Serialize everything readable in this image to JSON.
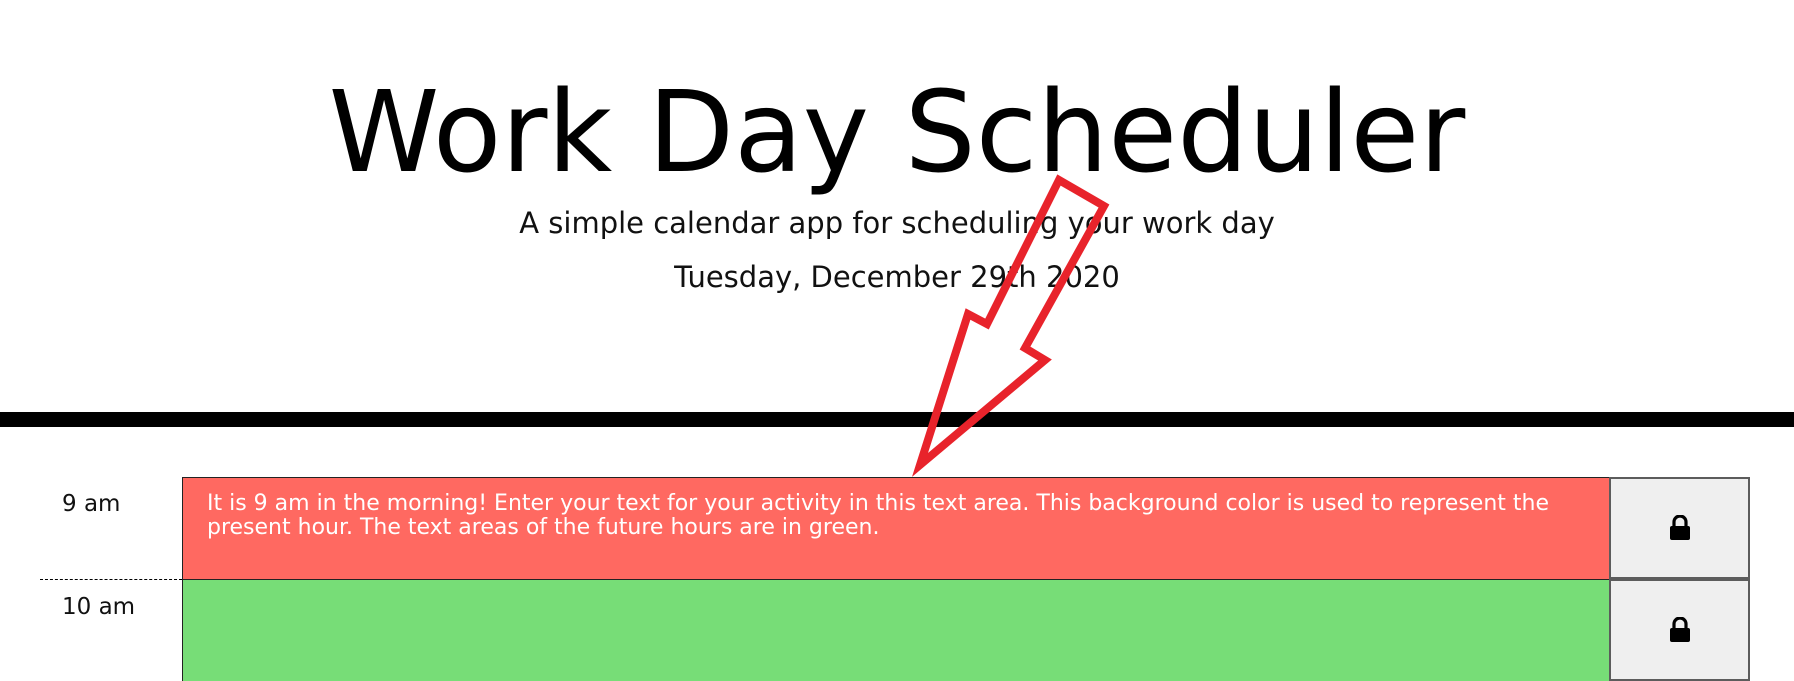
{
  "header": {
    "title": "Work Day Scheduler",
    "subtitle": "A simple calendar app for scheduling your work day",
    "date": "Tuesday, December 29th 2020"
  },
  "timeblocks": [
    {
      "hour": "9 am",
      "text": "It is 9 am in the morning! Enter your text for your activity in this text area. This background color is used to represent the present hour. The text areas of the future hours are in green.",
      "state": "present",
      "save_icon": "lock-icon"
    },
    {
      "hour": "10 am",
      "text": "",
      "state": "future",
      "save_icon": "lock-icon"
    }
  ],
  "colors": {
    "present": "#ff6961",
    "future": "#77dd77",
    "annotation_arrow": "#e8232b",
    "divider": "#000000"
  },
  "annotation": {
    "icon": "arrow-annotation-icon"
  }
}
